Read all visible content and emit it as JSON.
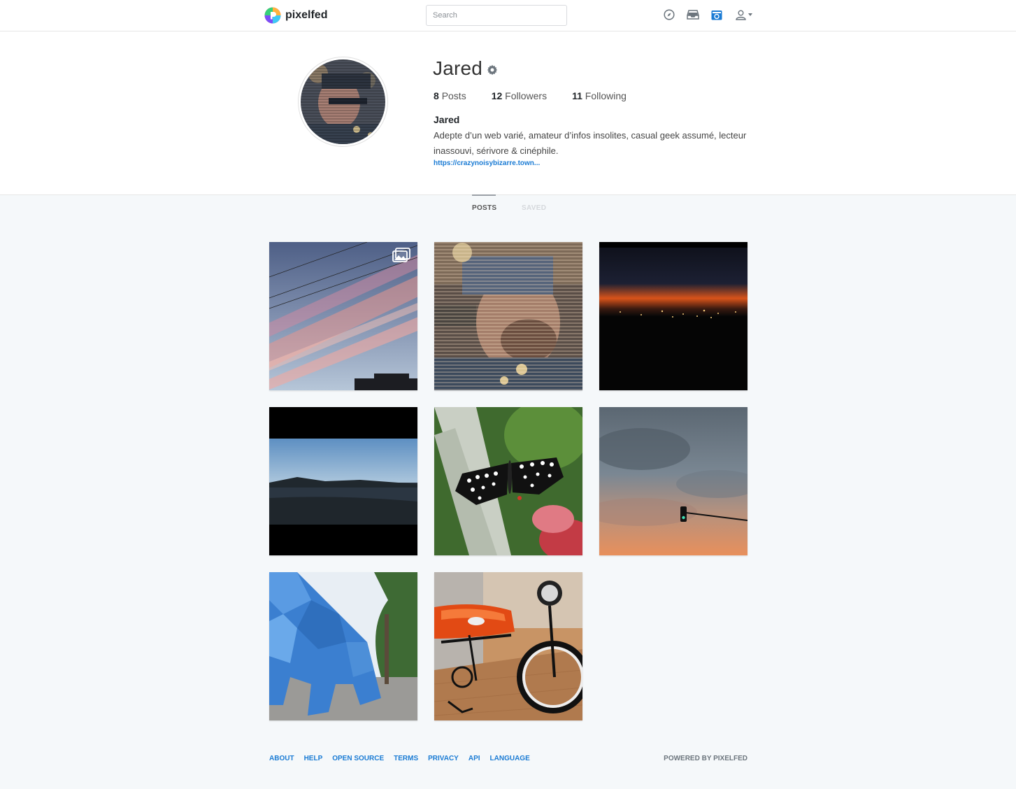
{
  "navbar": {
    "brand": "pixelfed",
    "search_placeholder": "Search",
    "icons": [
      "compass-icon",
      "inbox-icon",
      "camera-icon",
      "user-icon"
    ]
  },
  "profile": {
    "username": "Jared",
    "stats": {
      "posts_count": "8",
      "posts_label": "Posts",
      "followers_count": "12",
      "followers_label": "Followers",
      "following_count": "11",
      "following_label": "Following"
    },
    "display_name": "Jared",
    "bio": "Adepte d’un web varié, amateur d’infos insolites, casual geek assumé, lecteur inassouvi, sérivore & cinéphile.",
    "website": "https://crazynoisybizarre.town..."
  },
  "tabs": {
    "posts": "POSTS",
    "saved": "SAVED"
  },
  "posts": [
    {
      "subject": "pink sky with clouds and power lines",
      "album": true
    },
    {
      "subject": "glitched selfie portrait",
      "album": false
    },
    {
      "subject": "city lights at sunset",
      "album": false
    },
    {
      "subject": "river landscape at dusk",
      "album": false
    },
    {
      "subject": "black and white butterfly on leaves",
      "album": false
    },
    {
      "subject": "orange sunset sky with traffic light",
      "album": false
    },
    {
      "subject": "blue low-poly lion statue",
      "album": false
    },
    {
      "subject": "orange motorbike",
      "album": false
    }
  ],
  "footer": {
    "links": [
      "ABOUT",
      "HELP",
      "OPEN SOURCE",
      "TERMS",
      "PRIVACY",
      "API",
      "LANGUAGE"
    ],
    "powered_by": "POWERED BY PIXELFED"
  },
  "colors": {
    "accent": "#1a7bd4",
    "background": "#f5f8fa"
  }
}
